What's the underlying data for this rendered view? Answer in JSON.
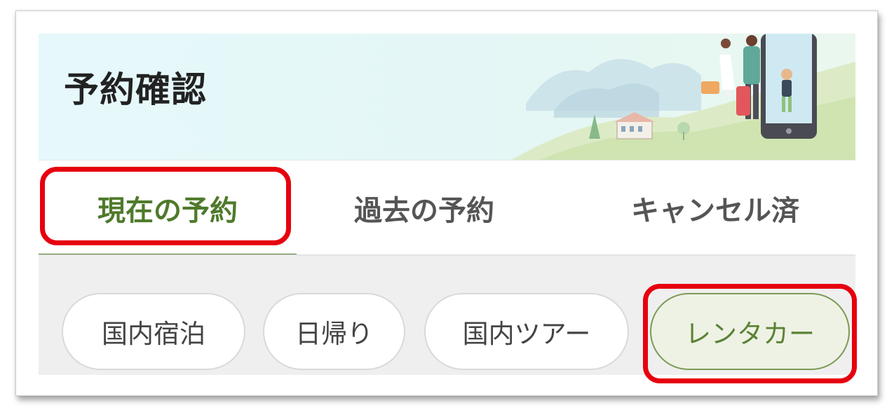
{
  "header": {
    "title": "予約確認"
  },
  "tabs": [
    {
      "label": "現在の予約",
      "active": true
    },
    {
      "label": "過去の予約",
      "active": false
    },
    {
      "label": "キャンセル済",
      "active": false
    }
  ],
  "categories": [
    {
      "label": "国内宿泊",
      "selected": false
    },
    {
      "label": "日帰り",
      "selected": false
    },
    {
      "label": "国内ツアー",
      "selected": false
    },
    {
      "label": "レンタカー",
      "selected": true
    }
  ],
  "colors": {
    "accent": "#4f7a2b",
    "highlight": "#e6000e",
    "selected_chip_bg": "#eef2e5"
  }
}
